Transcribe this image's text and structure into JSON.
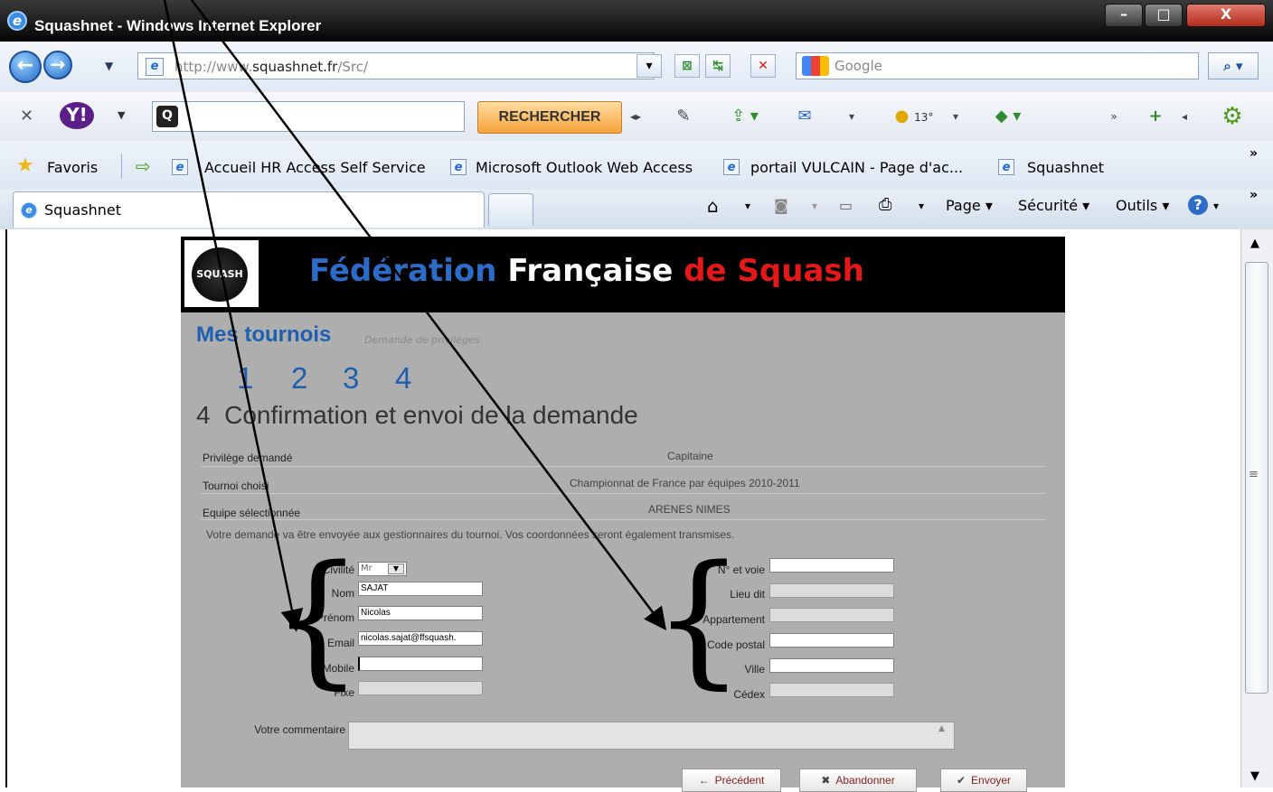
{
  "window": {
    "title": "Squashnet - Windows Internet Explorer",
    "controls": {
      "minimize": "–",
      "maximize": "□",
      "close": "X"
    }
  },
  "address_bar": {
    "url_prefix": "http://www.",
    "url_domain": "squashnet.fr",
    "url_path": "/Src/",
    "search_placeholder": "Google"
  },
  "yahoo_toolbar": {
    "logo": "Y!",
    "search_button": "RECHERCHER",
    "weather": "13°"
  },
  "favorites_bar": {
    "favorites_label": "Favoris",
    "items": [
      {
        "label": "Accueil HR Access Self Service"
      },
      {
        "label": "Microsoft Outlook Web Access"
      },
      {
        "label": "portail VULCAIN - Page d'ac..."
      },
      {
        "label": "Squashnet"
      }
    ]
  },
  "tabs": [
    {
      "label": "Squashnet",
      "active": true
    }
  ],
  "command_bar": {
    "page": "Page ▾",
    "securite": "Sécurité ▾",
    "outils": "Outils ▾"
  },
  "site": {
    "logo_text": "SQUASH",
    "header": {
      "part1": "Fédération",
      "part2": "Française",
      "part3": "de Squash"
    },
    "page_title": "Mes tournois",
    "page_subtitle": "Demande de privilèges",
    "steps": [
      "1",
      "2",
      "3",
      "4"
    ],
    "step_number": "4",
    "step_title": "Confirmation et envoi de la demande",
    "summary": [
      {
        "label": "Privilège demandé",
        "value": "Capitaine"
      },
      {
        "label": "Tournoi choisi",
        "value": "Championnat de France par équipes 2010-2011"
      },
      {
        "label": "Equipe sélectionnée",
        "value": "ARENES NIMES"
      }
    ],
    "notice": "Votre demande va être envoyée aux gestionnaires du tournoi. Vos coordonnées seront également transmises.",
    "form_left": [
      {
        "label": "Civilité",
        "value": "Mr",
        "type": "select"
      },
      {
        "label": "Nom",
        "value": "SAJAT",
        "type": "text"
      },
      {
        "label": "Prénom",
        "value": "Nicolas",
        "type": "text"
      },
      {
        "label": "Email",
        "value": "nicolas.sajat@ffsquash.",
        "type": "text"
      },
      {
        "label": "Mobile",
        "value": "",
        "type": "text"
      },
      {
        "label": "Fixe",
        "value": "",
        "type": "disabled"
      }
    ],
    "form_right": [
      {
        "label": "N° et voie",
        "value": "",
        "type": "text"
      },
      {
        "label": "Lieu dit",
        "value": "",
        "type": "disabled"
      },
      {
        "label": "Appartement",
        "value": "",
        "type": "disabled"
      },
      {
        "label": "Code postal",
        "value": "",
        "type": "text"
      },
      {
        "label": "Ville",
        "value": "",
        "type": "text"
      },
      {
        "label": "Cédex",
        "value": "",
        "type": "disabled"
      }
    ],
    "comment_label": "Votre commentaire",
    "buttons": {
      "previous": "Précédent",
      "abandon": "Abandonner",
      "send": "Envoyer"
    }
  }
}
